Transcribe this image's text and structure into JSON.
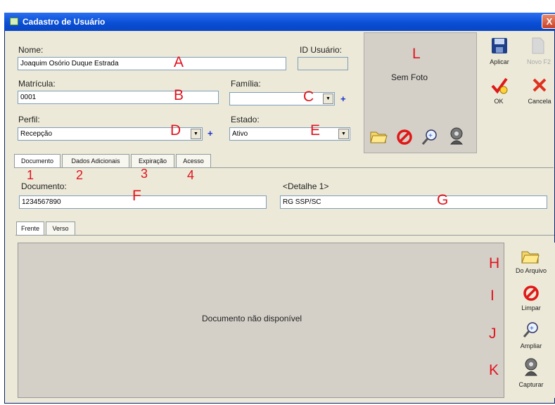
{
  "window": {
    "title": "Cadastro de Usuário",
    "close": "X"
  },
  "form": {
    "nome_label": "Nome:",
    "nome_value": "Joaquim Osório Duque Estrada",
    "id_label": "ID Usuário:",
    "id_value": "",
    "matricula_label": "Matrícula:",
    "matricula_value": "0001",
    "familia_label": "Família:",
    "familia_value": "",
    "perfil_label": "Perfil:",
    "perfil_value": "Recepção",
    "estado_label": "Estado:",
    "estado_value": "Ativo",
    "plus": "+"
  },
  "photo": {
    "placeholder": "Sem Foto"
  },
  "toolbar": {
    "aplicar": "Aplicar",
    "novo": "Novo F2",
    "ok": "OK",
    "cancela": "Cancela"
  },
  "tabs": [
    "Documento",
    "Dados Adicionais",
    "Expiração",
    "Acesso"
  ],
  "doc_tab": {
    "documento_label": "Documento:",
    "documento_value": "1234567890",
    "detalhe_label": "<Detalhe 1>",
    "detalhe_value": "RG SSP/SC",
    "subtabs": [
      "Frente",
      "Verso"
    ],
    "empty_text": "Documento não disponível"
  },
  "side_buttons": {
    "arquivo": "Do Arquivo",
    "limpar": "Limpar",
    "ampliar": "Ampliar",
    "capturar": "Capturar"
  },
  "annotations": {
    "A": "A",
    "B": "B",
    "C": "C",
    "D": "D",
    "E": "E",
    "F": "F",
    "G": "G",
    "H": "H",
    "I": "I",
    "J": "J",
    "K": "K",
    "L": "L",
    "n1": "1",
    "n2": "2",
    "n3": "3",
    "n4": "4"
  }
}
